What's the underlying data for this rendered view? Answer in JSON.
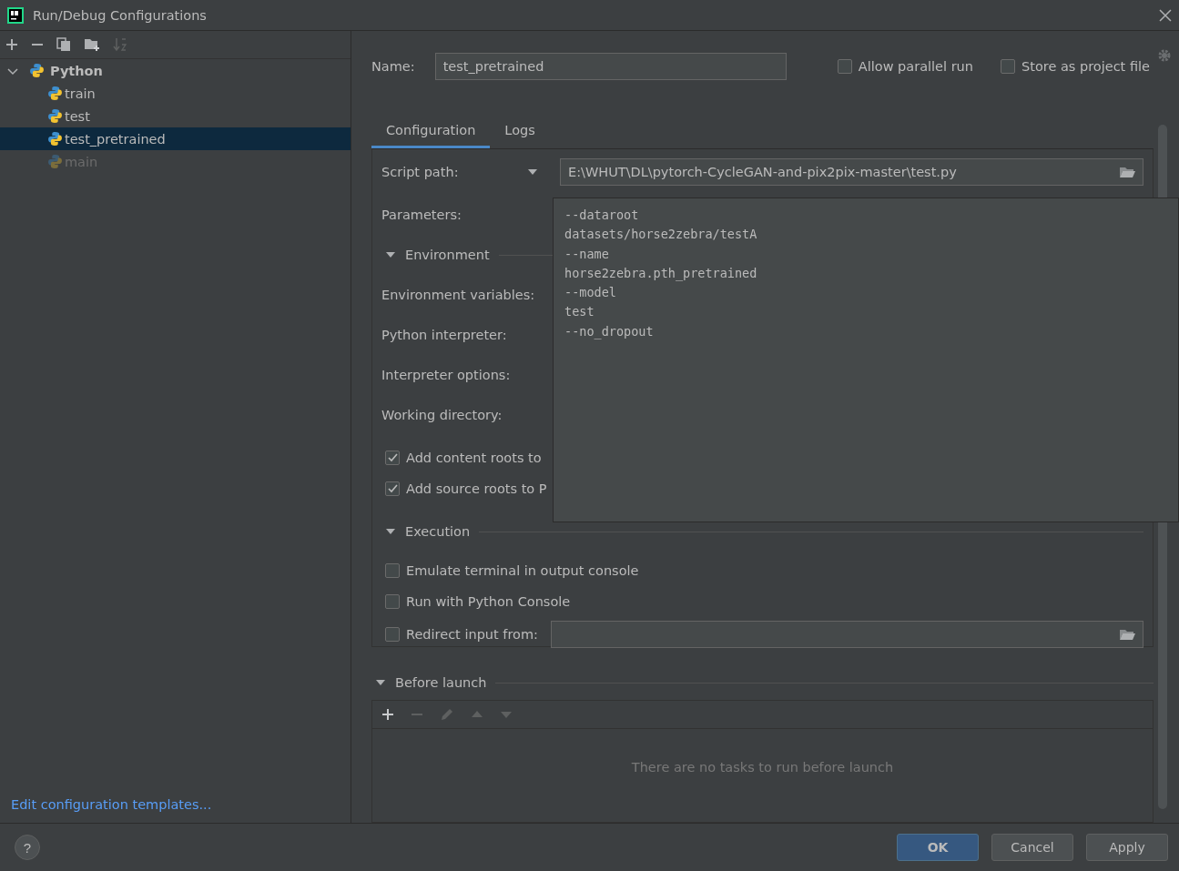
{
  "window": {
    "title": "Run/Debug Configurations"
  },
  "tree": [
    {
      "label": "Python",
      "expanded": true,
      "selected": false,
      "disabled": false,
      "children": [
        {
          "label": "train",
          "selected": false,
          "disabled": false
        },
        {
          "label": "test",
          "selected": false,
          "disabled": false
        },
        {
          "label": "test_pretrained",
          "selected": true,
          "disabled": false
        },
        {
          "label": "main",
          "selected": false,
          "disabled": true
        }
      ]
    }
  ],
  "templates_link": "Edit configuration templates...",
  "name_field": {
    "label": "Name:",
    "value": "test_pretrained"
  },
  "options": [
    {
      "label": "Allow parallel run",
      "checked": false
    },
    {
      "label": "Store as project file",
      "checked": false
    }
  ],
  "tabs": [
    {
      "label": "Configuration",
      "selected": true
    },
    {
      "label": "Logs",
      "selected": false
    }
  ],
  "form": [
    {
      "kind": "path",
      "label": "Script path:",
      "value": "E:\\WHUT\\DL\\pytorch-CycleGAN-and-pix2pix-master\\test.py"
    },
    {
      "kind": "label",
      "label": "Parameters:"
    },
    {
      "kind": "section",
      "label": "Environment",
      "expanded": true
    },
    {
      "kind": "label",
      "label": "Environment variables:"
    },
    {
      "kind": "label",
      "label": "Python interpreter:"
    },
    {
      "kind": "label",
      "label": "Interpreter options:"
    },
    {
      "kind": "label",
      "label": "Working directory:"
    },
    {
      "kind": "checkbox",
      "label": "Add content roots to",
      "checked": true
    },
    {
      "kind": "checkbox",
      "label": "Add source roots to P",
      "checked": true
    },
    {
      "kind": "section",
      "label": "Execution",
      "expanded": true
    },
    {
      "kind": "checkbox",
      "label": "Emulate terminal in output console",
      "checked": false
    },
    {
      "kind": "checkbox",
      "label": "Run with Python Console",
      "checked": false
    },
    {
      "kind": "checkbox_path",
      "label": "Redirect input from:",
      "checked": false
    }
  ],
  "parameters_popup": [
    "--dataroot",
    "datasets/horse2zebra/testA",
    "--name",
    "horse2zebra.pth_pretrained",
    "--model",
    "test",
    "--no_dropout"
  ],
  "before_launch": {
    "title": "Before launch",
    "expanded": true,
    "empty_text": "There are no tasks to run before launch"
  },
  "help_button": "?",
  "buttons": [
    {
      "label": "OK",
      "primary": true
    },
    {
      "label": "Cancel",
      "primary": false
    },
    {
      "label": "Apply",
      "primary": false
    }
  ]
}
